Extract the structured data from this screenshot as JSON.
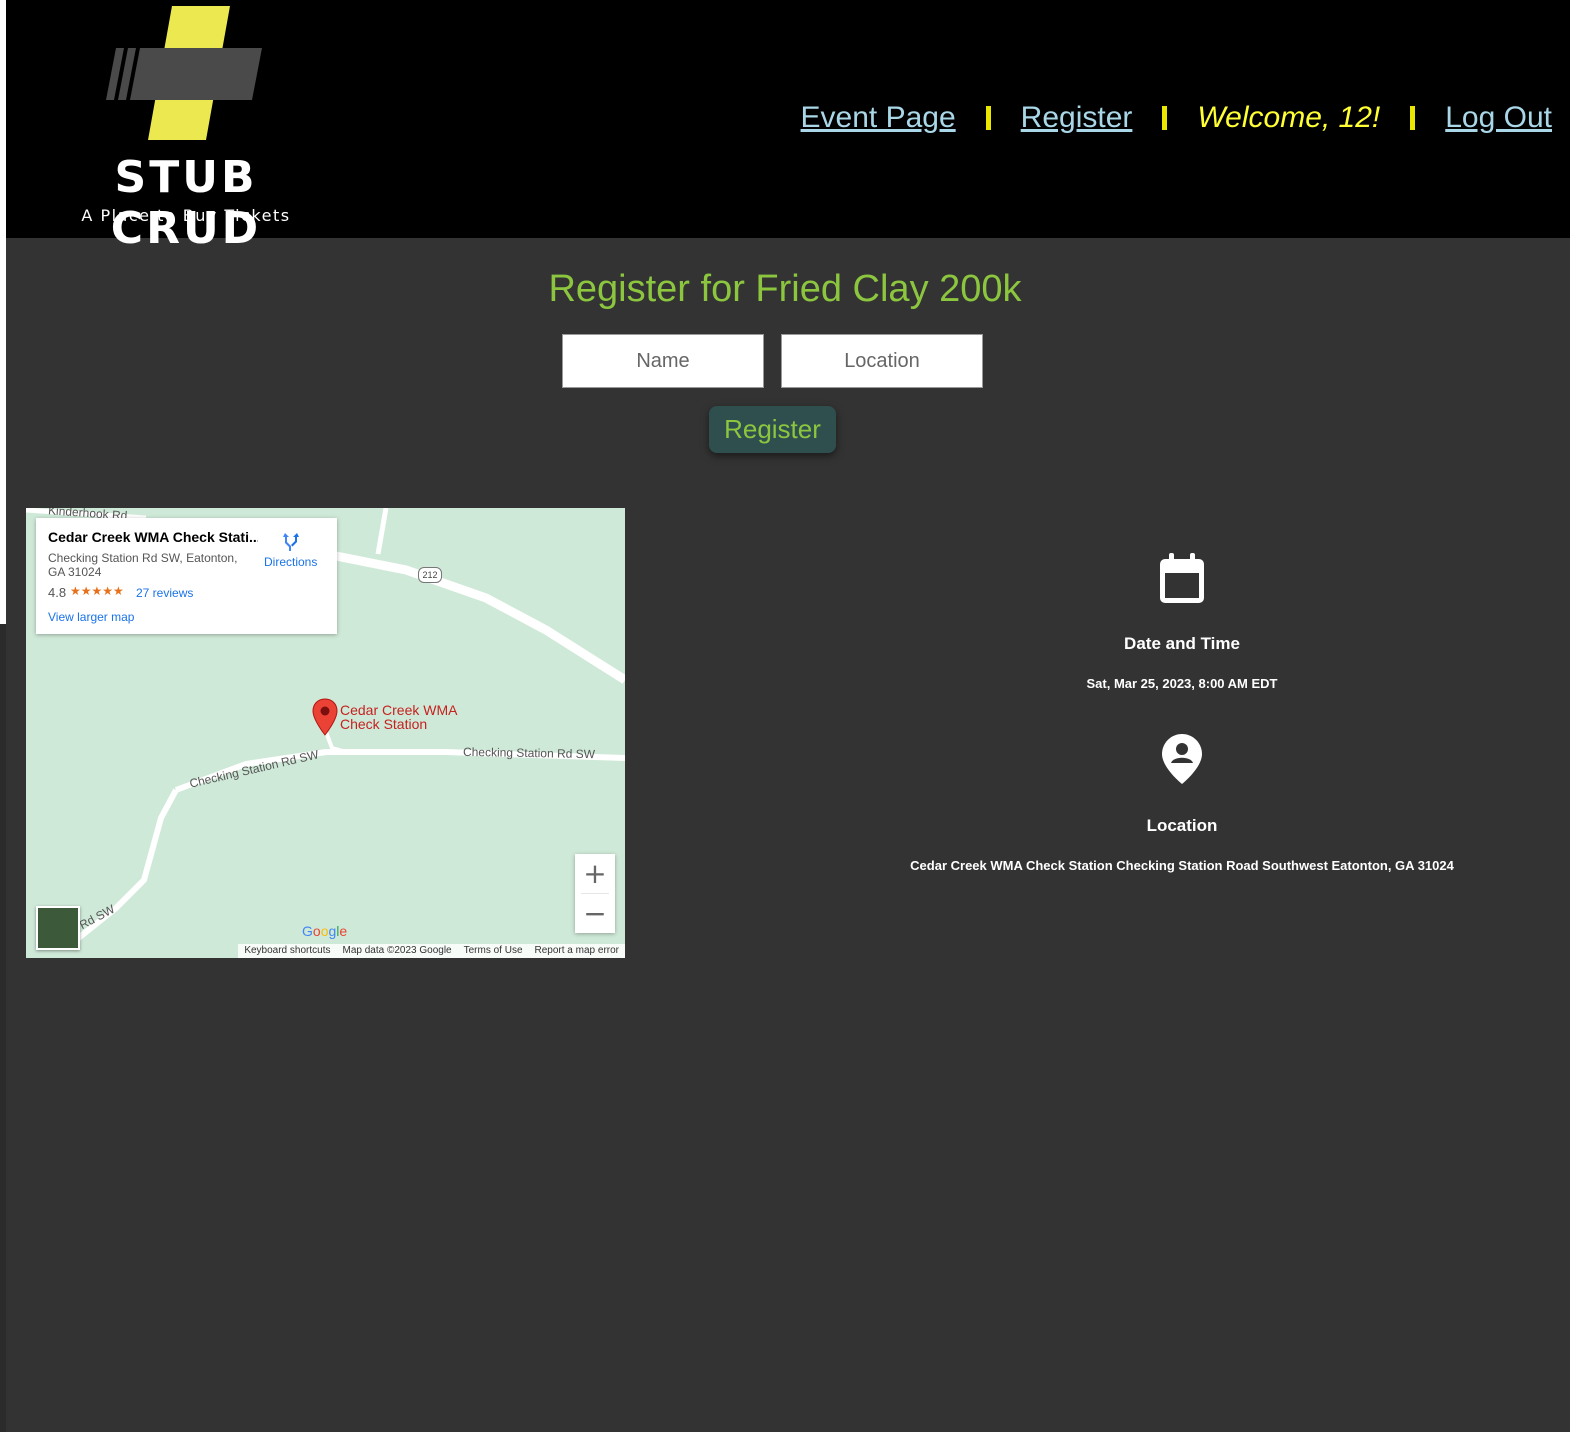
{
  "header": {
    "logo_word": "STUB CRUD",
    "logo_tagline": "A Place to Buy Tickets",
    "nav": {
      "event_page": "Event Page",
      "register": "Register",
      "welcome": "Welcome, 12!",
      "logout": "Log Out"
    }
  },
  "form": {
    "title": "Register for Fried Clay 200k",
    "name_placeholder": "Name",
    "location_placeholder": "Location",
    "submit_label": "Register"
  },
  "map": {
    "place_title": "Cedar Creek WMA Check Stati...",
    "place_address": "Checking Station Rd SW, Eatonton, GA 31024",
    "rating": "4.8",
    "stars": "★★★★★",
    "reviews": "27 reviews",
    "view_larger": "View larger map",
    "directions": "Directions",
    "pin_label_line1": "Cedar Creek WMA",
    "pin_label_line2": "Check Station",
    "road_top": "Kinderhook Rd",
    "road_a": "Checking Station Rd SW",
    "road_b": "Checking Station Rd SW",
    "road_c": "Rd SW",
    "highway": "212",
    "zoom_in": "+",
    "zoom_out": "−",
    "footer": {
      "keyboard": "Keyboard shortcuts",
      "data": "Map data ©2023 Google",
      "terms": "Terms of Use",
      "report": "Report a map error"
    }
  },
  "details": {
    "datetime_heading": "Date and Time",
    "datetime_value": "Sat, Mar 25, 2023, 8:00 AM EDT",
    "location_heading": "Location",
    "location_value": "Cedar Creek WMA Check Station Checking Station Road Southwest Eatonton, GA 31024"
  },
  "colors": {
    "accent_green": "#8cc63f",
    "nav_link": "#a9d7e8",
    "welcome_yellow": "#ffff33",
    "logo_yellow": "#ece84f",
    "background": "#333333"
  }
}
